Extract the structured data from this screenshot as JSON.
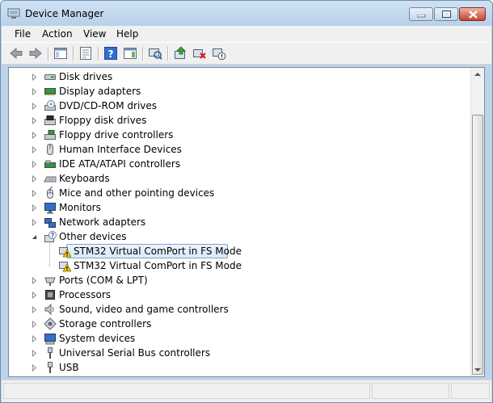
{
  "window": {
    "title": "Device Manager"
  },
  "menu": [
    "File",
    "Action",
    "View",
    "Help"
  ],
  "toolbar": {
    "buttons": [
      "back-icon",
      "forward-icon",
      "show-hide-console-tree-icon",
      "properties-icon",
      "help-icon",
      "show-hide-action-pane-icon",
      "scan-hardware-icon",
      "update-driver-icon",
      "uninstall-icon",
      "disable-icon"
    ]
  },
  "tree": {
    "items": [
      {
        "label": "Disk drives",
        "icon": "disk-drive-icon",
        "expanded": false,
        "level": 1
      },
      {
        "label": "Display adapters",
        "icon": "display-adapter-icon",
        "expanded": false,
        "level": 1
      },
      {
        "label": "DVD/CD-ROM drives",
        "icon": "dvd-drive-icon",
        "expanded": false,
        "level": 1
      },
      {
        "label": "Floppy disk drives",
        "icon": "floppy-disk-icon",
        "expanded": false,
        "level": 1
      },
      {
        "label": "Floppy drive controllers",
        "icon": "floppy-controller-icon",
        "expanded": false,
        "level": 1
      },
      {
        "label": "Human Interface Devices",
        "icon": "hid-icon",
        "expanded": false,
        "level": 1
      },
      {
        "label": "IDE ATA/ATAPI controllers",
        "icon": "ide-controller-icon",
        "expanded": false,
        "level": 1
      },
      {
        "label": "Keyboards",
        "icon": "keyboard-icon",
        "expanded": false,
        "level": 1
      },
      {
        "label": "Mice and other pointing devices",
        "icon": "mouse-icon",
        "expanded": false,
        "level": 1
      },
      {
        "label": "Monitors",
        "icon": "monitor-icon",
        "expanded": false,
        "level": 1
      },
      {
        "label": "Network adapters",
        "icon": "network-adapter-icon",
        "expanded": false,
        "level": 1
      },
      {
        "label": "Other devices",
        "icon": "unknown-device-icon",
        "expanded": true,
        "level": 1
      },
      {
        "label": "STM32 Virtual ComPort in FS Mode",
        "icon": "warning-device-icon",
        "level": 2,
        "selected": true
      },
      {
        "label": "STM32 Virtual ComPort in FS Mode",
        "icon": "warning-device-icon",
        "level": 2,
        "selected": false
      },
      {
        "label": "Ports (COM & LPT)",
        "icon": "port-icon",
        "expanded": false,
        "level": 1
      },
      {
        "label": "Processors",
        "icon": "processor-icon",
        "expanded": false,
        "level": 1
      },
      {
        "label": "Sound, video and game controllers",
        "icon": "sound-icon",
        "expanded": false,
        "level": 1
      },
      {
        "label": "Storage controllers",
        "icon": "storage-controller-icon",
        "expanded": false,
        "level": 1
      },
      {
        "label": "System devices",
        "icon": "system-device-icon",
        "expanded": false,
        "level": 1
      },
      {
        "label": "Universal Serial Bus controllers",
        "icon": "usb-controller-icon",
        "expanded": false,
        "level": 1
      },
      {
        "label": "USB",
        "icon": "usb-icon",
        "expanded": false,
        "level": 1
      }
    ]
  }
}
